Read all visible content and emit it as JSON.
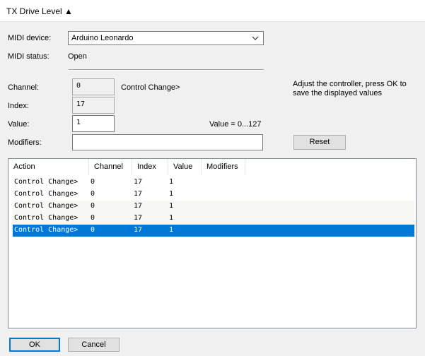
{
  "window": {
    "title": "TX Drive Level ▲"
  },
  "midi": {
    "device_label": "MIDI device:",
    "device_value": "Arduino Leonardo",
    "status_label": "MIDI status:",
    "status_value": "Open"
  },
  "form": {
    "channel_label": "Channel:",
    "channel_value": "0",
    "type_text": "Control Change>",
    "index_label": "Index:",
    "index_value": "17",
    "value_label": "Value:",
    "value_value": "1",
    "value_range": "Value = 0...127",
    "modifiers_label": "Modifiers:",
    "modifiers_value": "",
    "hint_line1": "Adjust the controller, press OK to",
    "hint_line2": "save the displayed values",
    "reset_label": "Reset"
  },
  "list": {
    "columns": [
      "Action",
      "Channel",
      "Index",
      "Value",
      "Modifiers"
    ],
    "rows": [
      {
        "action": "Control Change>",
        "channel": "0",
        "index": "17",
        "value": "1",
        "modifiers": ""
      },
      {
        "action": "Control Change>",
        "channel": "0",
        "index": "17",
        "value": "1",
        "modifiers": ""
      },
      {
        "action": "Control Change>",
        "channel": "0",
        "index": "17",
        "value": "1",
        "modifiers": ""
      },
      {
        "action": "Control Change>",
        "channel": "0",
        "index": "17",
        "value": "1",
        "modifiers": ""
      },
      {
        "action": "Control Change>",
        "channel": "0",
        "index": "17",
        "value": "1",
        "modifiers": ""
      }
    ],
    "selected_row": 5
  },
  "buttons": {
    "ok_label": "OK",
    "cancel_label": "Cancel"
  },
  "icons": {
    "dropdown": "chevron-down-icon"
  },
  "colors": {
    "selection": "#0078d7",
    "focus_border": "#0078d7"
  }
}
